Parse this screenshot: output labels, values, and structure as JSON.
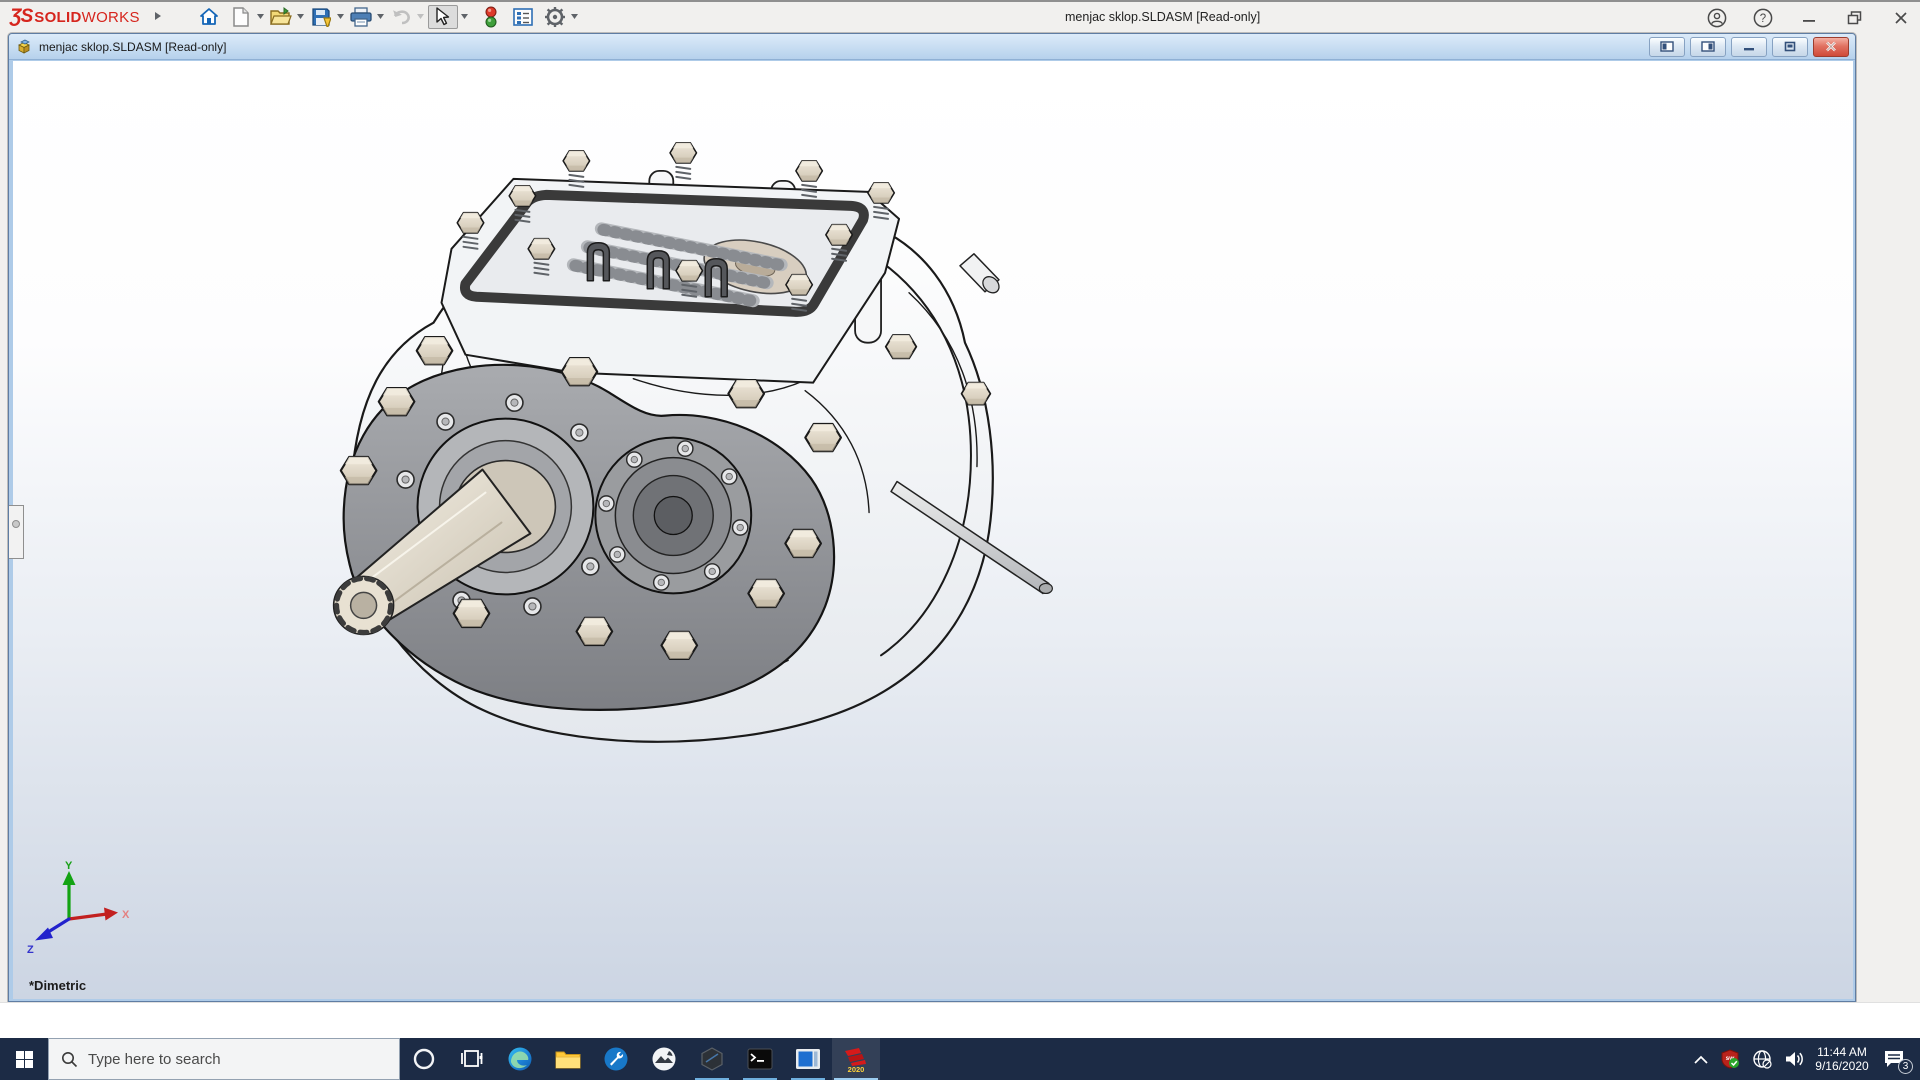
{
  "app": {
    "brand": {
      "glyph": "ƷS",
      "bold": "SOLID",
      "light": "WORKS"
    },
    "title": "menjac sklop.SLDASM [Read-only]",
    "quick_access_icons": [
      "home",
      "new-document",
      "open",
      "save",
      "print",
      "undo",
      "select-arrow",
      "traffic-light",
      "task-list",
      "options-gear"
    ],
    "window_controls": [
      "account",
      "help",
      "minimize",
      "maximize",
      "close"
    ]
  },
  "document_window": {
    "title": "menjac sklop.SLDASM [Read-only]",
    "controls": [
      "toggle-left-pane",
      "toggle-right-pane",
      "minimize",
      "restore",
      "close"
    ]
  },
  "viewport": {
    "view_label": "*Dimetric",
    "triad": {
      "x": "X",
      "y": "Y",
      "z": "Z"
    }
  },
  "taskbar": {
    "search_placeholder": "Type here to search",
    "icons": [
      "start",
      "cortana",
      "task-view",
      "edge",
      "file-explorer",
      "admin-tools",
      "photos",
      "hexagon-app",
      "command-prompt",
      "media-app",
      "solidworks-2020"
    ],
    "running_apps": [
      "hexagon-app",
      "command-prompt",
      "media-app",
      "solidworks-2020"
    ],
    "active_app": "solidworks-2020",
    "sw_year": "2020"
  },
  "tray": {
    "icons": [
      "hidden-icons-chevron",
      "solidworks-resource-monitor",
      "network-no-internet",
      "volume",
      "clock",
      "notifications"
    ],
    "time": "11:44 AM",
    "date": "9/16/2020",
    "notification_count": "3"
  },
  "colors": {
    "logo_red": "#d6251d",
    "taskbar": "#1c2b45",
    "running_indicator": "#6fb0df",
    "doc_titlebar": "#bdd6ef",
    "close_button_red": "#cf4a38",
    "toolbar_blue": "#1566b7"
  }
}
